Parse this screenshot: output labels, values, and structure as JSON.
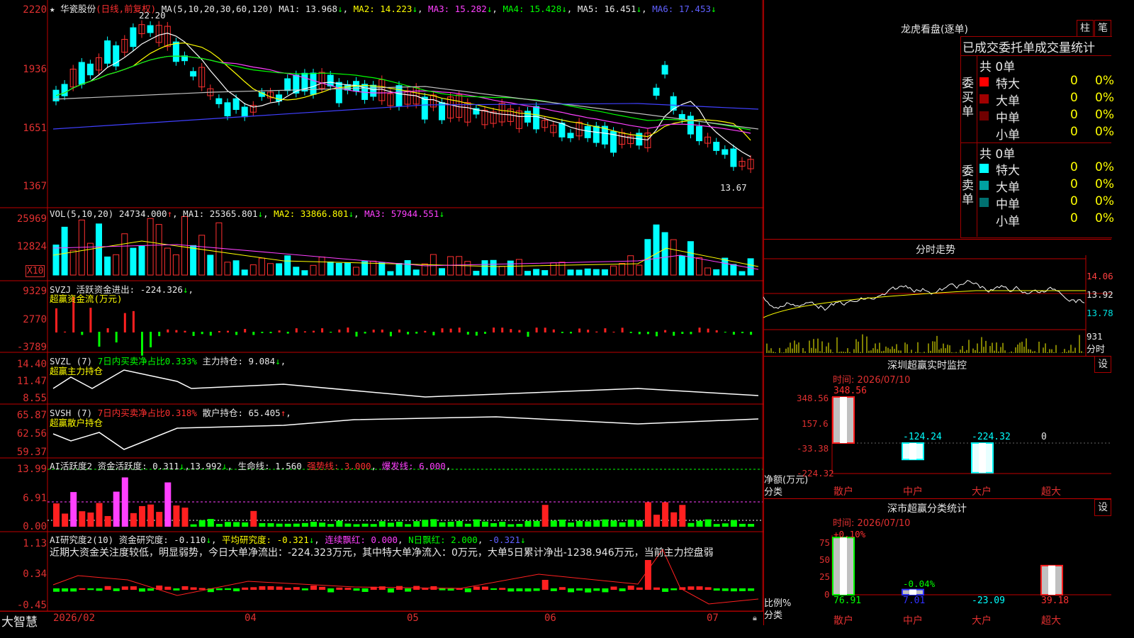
{
  "stock": {
    "name": "华瓷股份",
    "mode": "(日线,前复权)",
    "peak_label": "22.20",
    "low_label": "13.67"
  },
  "ma": {
    "label": "MA(5,10,20,30,60,120)",
    "ma1": "MA1: 13.968",
    "ma2": "MA2: 14.223",
    "ma3": "MA3: 15.282",
    "ma4": "MA4: 15.428",
    "ma5": "MA5: 16.451",
    "ma6": "MA6: 17.453"
  },
  "price_axis": [
    "2220",
    "1936",
    "1651",
    "1367"
  ],
  "vol": {
    "label": "VOL(5,10,20)",
    "value": "24734.000",
    "ma1": "MA1: 25365.801",
    "ma2": "MA2: 33866.801",
    "ma3": "MA3: 57944.551",
    "axis": [
      "25969",
      "12824"
    ],
    "unit": "X10"
  },
  "svzj": {
    "label": "SVZJ",
    "text": "活跃资金进出: -224.326",
    "sub": "超赢资金流(万元)",
    "axis": [
      "9329",
      "2770",
      "-3789"
    ]
  },
  "svzl": {
    "label": "SVZL (7)",
    "text1": "7日内买卖净占比0.333%",
    "text2": "主力持仓: 9.084",
    "sub": "超赢主力持仓",
    "axis": [
      "14.40",
      "11.47",
      "8.55"
    ]
  },
  "svsh": {
    "label": "SVSH (7)",
    "text1": "7日内买卖净占比0.318%",
    "text2": "散户持仓: 65.405",
    "sub": "超赢散户持仓",
    "axis": [
      "65.87",
      "62.56",
      "59.37"
    ]
  },
  "ai1": {
    "label": "AI活跃度2",
    "text1": "资金活跃度: 0.311",
    "text2": "13.992",
    "text3": "生命线: 1.560",
    "text4": "强势线: 3.000",
    "text5": "爆发线: 6.000",
    "axis": [
      "13.99",
      "6.91",
      "0.00"
    ]
  },
  "ai2": {
    "label": "AI研究度2(10)",
    "text1": "资金研究度: -0.110",
    "text2": "平均研究度: -0.321",
    "text3": "连续飘红: 0.000",
    "text4": "N日飘红: 2.000",
    "text5": "-0.321",
    "axis": [
      "1.13",
      "0.34",
      "-0.45"
    ],
    "comment": "近期大资金关注度较低，明显弱势，今日大单净流出：-224.323万元，其中特大单净流入：0万元，大单5日累计净出-1238.946万元，当前主力控盘弱"
  },
  "dates": [
    "2026/02",
    "04",
    "05",
    "06",
    "07"
  ],
  "brand": "大智慧",
  "lhb": {
    "title": "龙虎看盘(逐单)",
    "btn1": "柱",
    "btn2": "笔",
    "header": "已成交委托单成交量统计",
    "buy_label": "委买单",
    "sell_label": "委卖单",
    "buy_total": "共 0单",
    "sell_total": "共 0单",
    "buy_rows": [
      {
        "name": "特大",
        "n": "0",
        "p": "0%",
        "color": "#ff0000"
      },
      {
        "name": "大单",
        "n": "0",
        "p": "0%",
        "color": "#a00000"
      },
      {
        "name": "中单",
        "n": "0",
        "p": "0%",
        "color": "#700000"
      },
      {
        "name": "小单",
        "n": "0",
        "p": "0%",
        "color": ""
      }
    ],
    "sell_rows": [
      {
        "name": "特大",
        "n": "0",
        "p": "0%",
        "color": "#00ffff"
      },
      {
        "name": "大单",
        "n": "0",
        "p": "0%",
        "color": "#00a0a0"
      },
      {
        "name": "中单",
        "n": "0",
        "p": "0%",
        "color": "#007070"
      },
      {
        "name": "小单",
        "n": "0",
        "p": "0%",
        "color": ""
      }
    ]
  },
  "fenshi": {
    "title": "分时走势",
    "axis": [
      "14.06",
      "13.92",
      "13.78"
    ],
    "vol_label": "931",
    "tag": "分时"
  },
  "monitor": {
    "title": "深圳超赢实时监控",
    "btn": "设",
    "time": "时间: 2026/07/10",
    "axis": [
      "348.56",
      "157.6",
      "-33.38",
      "-224.32"
    ],
    "unit": "净额(万元)",
    "cat_label": "分类",
    "cats": [
      "散户",
      "中户",
      "大户",
      "超大"
    ],
    "values": [
      348.56,
      -124.24,
      -224.32,
      0
    ],
    "value_labels": [
      "348.56",
      "-124.24",
      "-224.32",
      "0"
    ]
  },
  "classify": {
    "title": "深市超赢分类统计",
    "btn": "设",
    "time": "时间: 2026/07/10",
    "axis": [
      "75",
      "50",
      "25",
      "0"
    ],
    "unit": "比例%",
    "cat_label": "分类",
    "cats": [
      "散户",
      "中户",
      "大户",
      "超大"
    ],
    "values": [
      76.91,
      7.01,
      -23.09,
      39.18
    ],
    "value_labels": [
      "76.91",
      "7.01",
      "-23.09",
      "39.18"
    ],
    "top_labels": [
      "+0.10%",
      "-0.04%"
    ]
  }
}
